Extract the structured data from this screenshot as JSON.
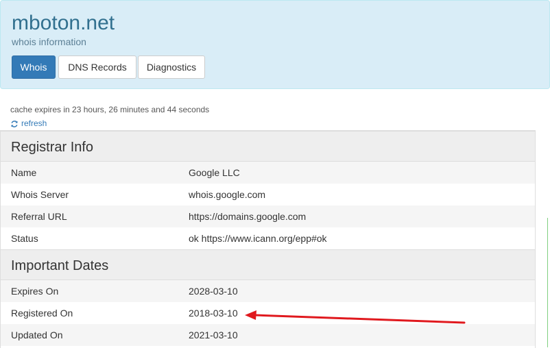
{
  "header": {
    "title": "mboton.net",
    "subtitle": "whois information",
    "tabs": [
      {
        "label": "Whois",
        "active": true
      },
      {
        "label": "DNS Records",
        "active": false
      },
      {
        "label": "Diagnostics",
        "active": false
      }
    ]
  },
  "cache": {
    "text": "cache expires in 23 hours, 26 minutes and 44 seconds",
    "refresh_label": "refresh",
    "refresh_icon": "refresh-icon"
  },
  "registrar": {
    "heading": "Registrar Info",
    "rows": [
      {
        "label": "Name",
        "value": "Google LLC"
      },
      {
        "label": "Whois Server",
        "value": "whois.google.com"
      },
      {
        "label": "Referral URL",
        "value": "https://domains.google.com"
      },
      {
        "label": "Status",
        "value": "ok https://www.icann.org/epp#ok"
      }
    ]
  },
  "dates": {
    "heading": "Important Dates",
    "rows": [
      {
        "label": "Expires On",
        "value": "2028-03-10"
      },
      {
        "label": "Registered On",
        "value": "2018-03-10"
      },
      {
        "label": "Updated On",
        "value": "2021-03-10"
      }
    ]
  },
  "annotation": {
    "arrow_color": "#e0191e",
    "icon": "red-arrow-annotation"
  },
  "colors": {
    "header_bg": "#d9edf7",
    "title": "#31708f",
    "primary": "#337ab7",
    "section_bg": "#eeeeee"
  }
}
